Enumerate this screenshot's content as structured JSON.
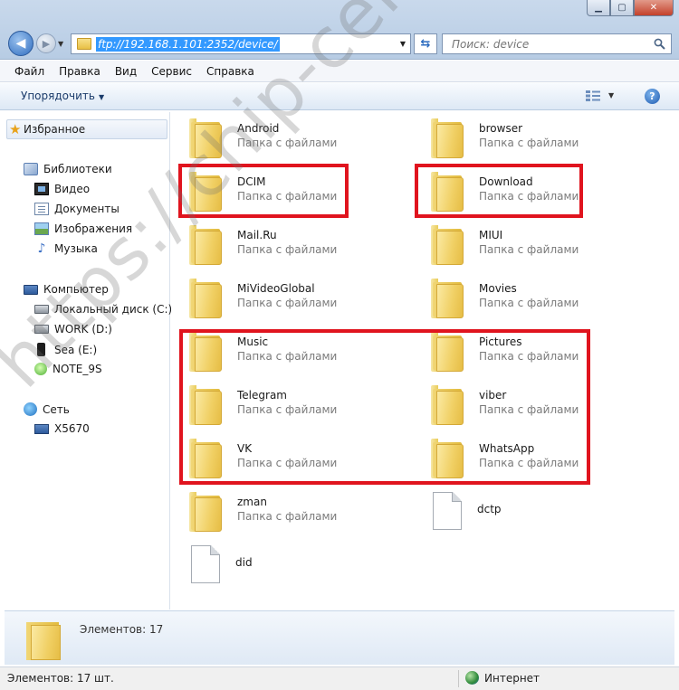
{
  "address": {
    "path": "ftp://192.168.1.101:2352/device/"
  },
  "search": {
    "placeholder": "Поиск: device"
  },
  "menu": [
    "Файл",
    "Правка",
    "Вид",
    "Сервис",
    "Справка"
  ],
  "toolbar": {
    "organize": "Упорядочить"
  },
  "nav": {
    "favorites": "Избранное",
    "libraries": "Библиотеки",
    "lib_items": [
      "Видео",
      "Документы",
      "Изображения",
      "Музыка"
    ],
    "computer": "Компьютер",
    "drives": [
      "Локальный диск (C:)",
      "WORK (D:)",
      "Sea (E:)",
      "NOTE_9S"
    ],
    "network": "Сеть",
    "net_items": [
      "X5670"
    ]
  },
  "items": [
    {
      "name": "Android",
      "type": "Папка с файлами",
      "kind": "folder"
    },
    {
      "name": "browser",
      "type": "Папка с файлами",
      "kind": "folder"
    },
    {
      "name": "DCIM",
      "type": "Папка с файлами",
      "kind": "folder"
    },
    {
      "name": "Download",
      "type": "Папка с файлами",
      "kind": "folder"
    },
    {
      "name": "Mail.Ru",
      "type": "Папка с файлами",
      "kind": "folder"
    },
    {
      "name": "MIUI",
      "type": "Папка с файлами",
      "kind": "folder"
    },
    {
      "name": "MiVideoGlobal",
      "type": "Папка с файлами",
      "kind": "folder"
    },
    {
      "name": "Movies",
      "type": "Папка с файлами",
      "kind": "folder"
    },
    {
      "name": "Music",
      "type": "Папка с файлами",
      "kind": "folder"
    },
    {
      "name": "Pictures",
      "type": "Папка с файлами",
      "kind": "folder"
    },
    {
      "name": "Telegram",
      "type": "Папка с файлами",
      "kind": "folder"
    },
    {
      "name": "viber",
      "type": "Папка с файлами",
      "kind": "folder"
    },
    {
      "name": "VK",
      "type": "Папка с файлами",
      "kind": "folder"
    },
    {
      "name": "WhatsApp",
      "type": "Папка с файлами",
      "kind": "folder"
    },
    {
      "name": "zman",
      "type": "Папка с файлами",
      "kind": "folder"
    },
    {
      "name": "dctp",
      "type": "",
      "kind": "file"
    },
    {
      "name": "did",
      "type": "",
      "kind": "file"
    }
  ],
  "details": {
    "count": "Элементов: 17"
  },
  "status": {
    "left": "Элементов: 17 шт.",
    "zone": "Интернет"
  },
  "watermark": "https://chip-center.ru",
  "colors": {
    "highlight": "#e0141e",
    "selection": "#3399ff"
  }
}
